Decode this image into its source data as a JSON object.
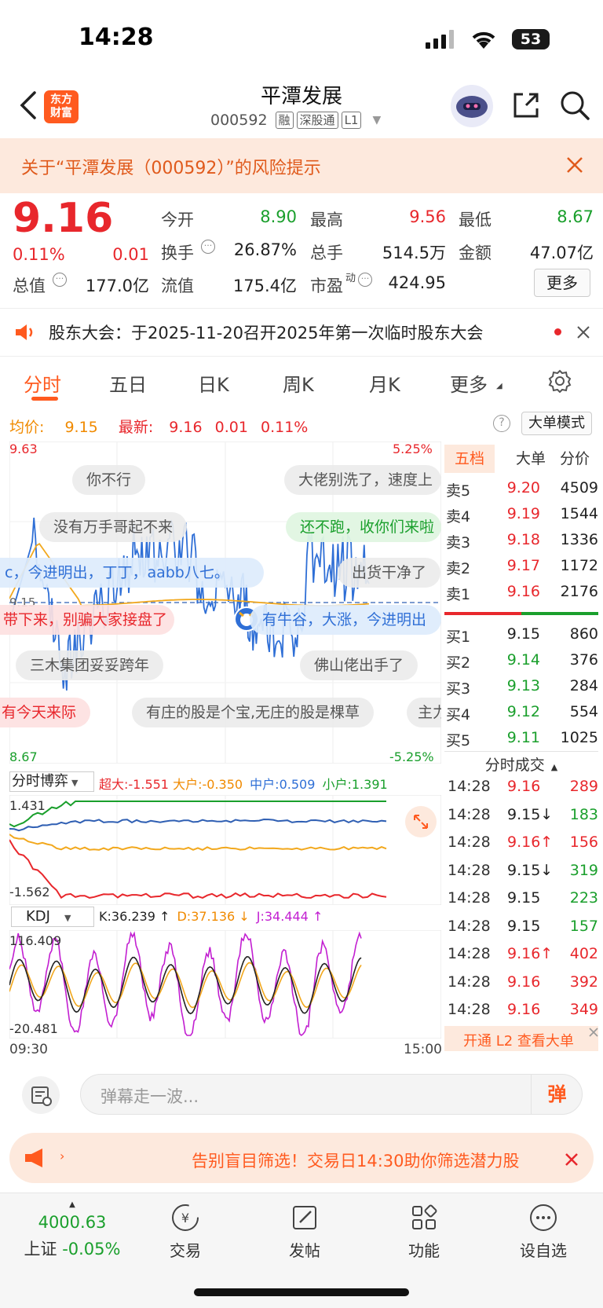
{
  "status": {
    "time": "14:28",
    "battery": "53"
  },
  "header": {
    "logo_line1": "东方",
    "logo_line2": "财富",
    "title": "平潭发展",
    "code": "000592",
    "tags": [
      "融",
      "深股通",
      "L1"
    ]
  },
  "risk_banner": {
    "text": "关于“平潭发展（000592）”的风险提示"
  },
  "quote": {
    "price": "9.16",
    "change_pct": "0.11%",
    "change": "0.01",
    "open_label": "今开",
    "open": "8.90",
    "high_label": "最高",
    "high": "9.56",
    "low_label": "最低",
    "low": "8.67",
    "turnover_label": "换手",
    "turnover": "26.87%",
    "volume_label": "总手",
    "volume": "514.5万",
    "amount_label": "金额",
    "amount": "47.07亿",
    "mcap_label": "总值",
    "mcap": "177.0亿",
    "float_label": "流值",
    "float": "175.4亿",
    "pe_label": "市盈",
    "pe_sup": "动",
    "pe": "424.95",
    "more_label": "更多"
  },
  "announce": {
    "text": "股东大会：于2025-11-20召开2025年第一次临时股东大会"
  },
  "tabs": [
    "分时",
    "五日",
    "日K",
    "周K",
    "月K",
    "更多"
  ],
  "chart_info": {
    "avg_label": "均价:",
    "avg": "9.15",
    "latest_label": "最新:",
    "latest": "9.16",
    "latest_change": "0.01",
    "latest_pct": "0.11%",
    "big_order_mode": "大单模式",
    "top_price": "9.63",
    "top_pct": "5.25%",
    "bottom_price": "8.67",
    "bottom_pct": "-5.25%",
    "ref_price": "9.15",
    "time_start": "09:30",
    "time_end": "15:00"
  },
  "danmu": [
    "你不行",
    "大佬别洗了，速度上",
    "没有万手哥起不来",
    "还不跑，收你们来啦",
    "c，今进明出，丁丁，aabb八七。",
    "出货干净了",
    "带下来，别骗大家接盘了",
    "有牛谷，大涨，今进明出",
    "三木集团妥妥跨年",
    "佛山佬出手了",
    "有今天来际",
    "有庄的股是个宝,无庄的股是棵草",
    "主力"
  ],
  "fund_flow": {
    "selector": "分时博弈",
    "super_label": "超大:",
    "super": "-1.551",
    "big_label": "大户:",
    "big": "-0.350",
    "mid_label": "中户:",
    "mid": "0.509",
    "small_label": "小户:",
    "small": "1.391",
    "ymax": "1.431",
    "ymin": "-1.562",
    "colors": {
      "super": "#e8272c",
      "big": "#f2a81d",
      "mid": "#2f5fb3",
      "small": "#1a9f2c"
    }
  },
  "kdj": {
    "selector": "KDJ",
    "k_label": "K:",
    "k": "36.239 ↑",
    "d_label": "D:",
    "d": "37.136 ↓",
    "j_label": "J:",
    "j": "34.444 ↑",
    "ymax": "116.409",
    "ymin": "-20.481"
  },
  "orderbook": {
    "tabs": [
      "五档",
      "大单",
      "分价"
    ],
    "asks": [
      {
        "label": "卖5",
        "price": "9.20",
        "vol": "4509"
      },
      {
        "label": "卖4",
        "price": "9.19",
        "vol": "1544"
      },
      {
        "label": "卖3",
        "price": "9.18",
        "vol": "1336"
      },
      {
        "label": "卖2",
        "price": "9.17",
        "vol": "1172"
      },
      {
        "label": "卖1",
        "price": "9.16",
        "vol": "2176"
      }
    ],
    "bids": [
      {
        "label": "买1",
        "price": "9.15",
        "vol": "860"
      },
      {
        "label": "买2",
        "price": "9.14",
        "vol": "376"
      },
      {
        "label": "买3",
        "price": "9.13",
        "vol": "284"
      },
      {
        "label": "买4",
        "price": "9.12",
        "vol": "554"
      },
      {
        "label": "买5",
        "price": "9.11",
        "vol": "1025"
      }
    ]
  },
  "trades": {
    "title": "分时成交",
    "rows": [
      {
        "time": "14:28",
        "price": "9.16",
        "vol": "289",
        "dir": "up"
      },
      {
        "time": "14:28",
        "price": "9.15↓",
        "vol": "183",
        "dir": "down"
      },
      {
        "time": "14:28",
        "price": "9.16↑",
        "vol": "156",
        "dir": "up"
      },
      {
        "time": "14:28",
        "price": "9.15↓",
        "vol": "319",
        "dir": "down"
      },
      {
        "time": "14:28",
        "price": "9.15",
        "vol": "223",
        "dir": "down"
      },
      {
        "time": "14:28",
        "price": "9.15",
        "vol": "157",
        "dir": "down"
      },
      {
        "time": "14:28",
        "price": "9.16↑",
        "vol": "402",
        "dir": "up"
      },
      {
        "time": "14:28",
        "price": "9.16",
        "vol": "392",
        "dir": "up"
      },
      {
        "time": "14:28",
        "price": "9.16",
        "vol": "349",
        "dir": "up"
      }
    ],
    "l2_promo": "开通 L2 查看大单"
  },
  "input": {
    "placeholder": "弹幕走一波...",
    "send_label": "弹"
  },
  "promo": {
    "text": "告别盲目筛选！交易日14:30助你筛选潜力股"
  },
  "bottom_nav": {
    "index_value": "4000.63",
    "index_name": "上证",
    "index_change": "-0.05%",
    "items": [
      "交易",
      "发帖",
      "功能",
      "设自选"
    ]
  }
}
